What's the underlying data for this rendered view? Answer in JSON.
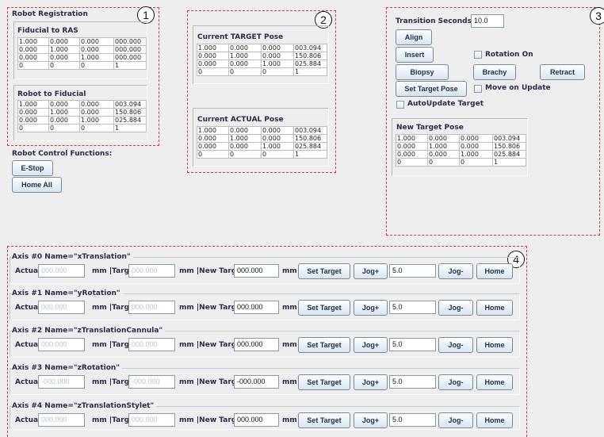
{
  "callouts": [
    "1",
    "2",
    "3",
    "4"
  ],
  "registration": {
    "title": "Robot Registration",
    "fiducial_to_ras": {
      "title": "Fiducial to RAS",
      "rows": [
        [
          "1.000",
          "0.000",
          "0.000",
          "000.000"
        ],
        [
          "0.000",
          "1.000",
          "0.000",
          "000.000"
        ],
        [
          "0.000",
          "0.000",
          "1.000",
          "000.000"
        ],
        [
          "0",
          "0",
          "0",
          "1"
        ]
      ]
    },
    "robot_to_fiducial": {
      "title": "Robot to Fiducial",
      "rows": [
        [
          "1.000",
          "0.000",
          "0.000",
          "003.094"
        ],
        [
          "0.000",
          "1.000",
          "0.000",
          "150.806"
        ],
        [
          "0.000",
          "0.000",
          "1.000",
          "025.884"
        ],
        [
          "0",
          "0",
          "0",
          "1"
        ]
      ]
    }
  },
  "control": {
    "title": "Robot Control Functions:",
    "estop": "E-Stop",
    "home_all": "Home All"
  },
  "poses": {
    "target": {
      "title": "Current TARGET Pose",
      "rows": [
        [
          "1.000",
          "0.000",
          "0.000",
          "003.094"
        ],
        [
          "0.000",
          "1.000",
          "0.000",
          "150.806"
        ],
        [
          "0.000",
          "0.000",
          "1.000",
          "025.884"
        ],
        [
          "0",
          "0",
          "0",
          "1"
        ]
      ]
    },
    "actual": {
      "title": "Current ACTUAL Pose",
      "rows": [
        [
          "1.000",
          "0.000",
          "0.000",
          "003.094"
        ],
        [
          "0.000",
          "1.000",
          "0.000",
          "150.806"
        ],
        [
          "0.000",
          "0.000",
          "1.000",
          "025.884"
        ],
        [
          "0",
          "0",
          "0",
          "1"
        ]
      ]
    }
  },
  "transition": {
    "label": "Transition Seconds",
    "value": "10.0",
    "align": "Align",
    "insert": "Insert",
    "rotation_on": "Rotation On",
    "biopsy": "Biopsy",
    "brachy": "Brachy",
    "retract": "Retract",
    "set_target_pose": "Set Target Pose",
    "move_on_update": "Move on Update",
    "autoupdate_target": "AutoUpdate Target",
    "new_target_pose": {
      "title": "New Target Pose",
      "rows": [
        [
          "1.000",
          "0.000",
          "0.000",
          "003.094"
        ],
        [
          "0.000",
          "1.000",
          "0.000",
          "150.806"
        ],
        [
          "0.000",
          "0.000",
          "1.000",
          "025.884"
        ],
        [
          "0",
          "0",
          "0",
          "1"
        ]
      ]
    }
  },
  "axis_labels": {
    "actual": "Actual",
    "mm_target": "mm |Target",
    "mm_new_target": "mm |New Target",
    "mm": "mm",
    "set_target": "Set Target",
    "jog_plus": "Jog+",
    "jog_minus": "Jog-",
    "home": "Home"
  },
  "axes": [
    {
      "title": "Axis #0 Name=\"xTranslation\"",
      "actual": "000.000",
      "target": "000.000",
      "new_target": "000.000",
      "jog": "5.0"
    },
    {
      "title": "Axis #1 Name=\"yRotation\"",
      "actual": "000.000",
      "target": "000.000",
      "new_target": "000.000",
      "jog": "5.0"
    },
    {
      "title": "Axis #2 Name=\"zTranslationCannula\"",
      "actual": "000.000",
      "target": "000.000",
      "new_target": "000.000",
      "jog": "5.0"
    },
    {
      "title": "Axis #3 Name=\"zRotation\"",
      "actual": "-000.000",
      "target": "-000.000",
      "new_target": "-000.000",
      "jog": "5.0"
    },
    {
      "title": "Axis #4 Name=\"zTranslationStylet\"",
      "actual": "000.000",
      "target": "000.000",
      "new_target": "000.000",
      "jog": "5.0"
    }
  ],
  "colors": {
    "callout_dash": "#e0303a",
    "button_text": "#1d2f4d",
    "label_text": "#2b2b4a"
  }
}
